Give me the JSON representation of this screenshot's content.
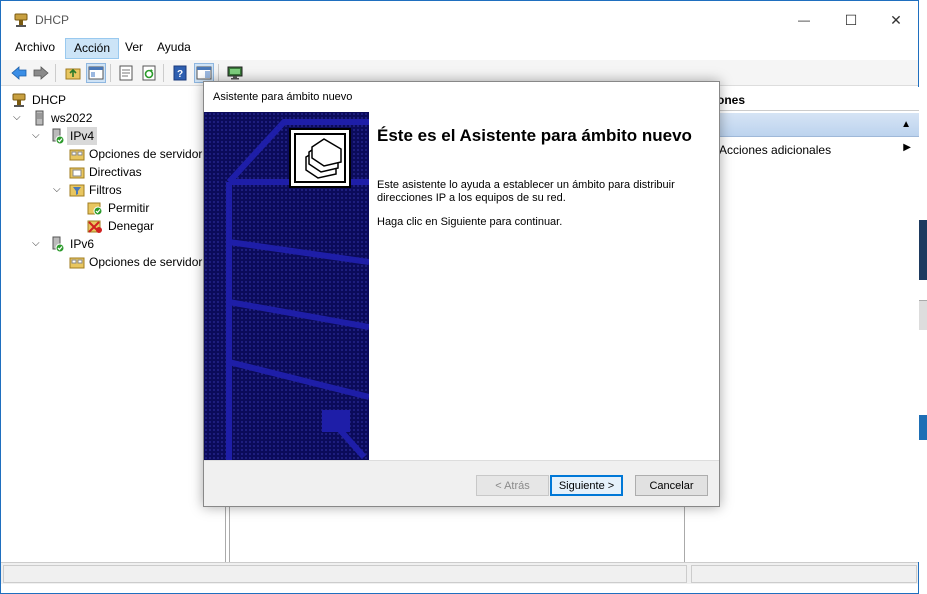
{
  "window": {
    "title": "DHCP",
    "minimize": "—",
    "maximize": "☐",
    "close": "✕"
  },
  "menu": {
    "items": [
      "Archivo",
      "Acción",
      "Ver",
      "Ayuda"
    ],
    "active": "Acción"
  },
  "tree": {
    "root": "DHCP",
    "server": "ws2022",
    "ipv4": "IPv4",
    "ipv4_children": [
      "Opciones de servidor",
      "Directivas",
      "Filtros"
    ],
    "filtros_children": [
      "Permitir",
      "Denegar"
    ],
    "ipv6": "IPv6",
    "ipv6_children": [
      "Opciones de servidor"
    ]
  },
  "actions": {
    "header": "ones",
    "item": "Acciones adicionales"
  },
  "dialog": {
    "title": "Asistente para ámbito nuevo",
    "heading": "Éste es el Asistente para ámbito nuevo",
    "paragraph1": "Este asistente lo ayuda a establecer un ámbito para distribuir direcciones IP a los equipos de su red.",
    "paragraph2": "Haga clic en Siguiente para continuar.",
    "back_label": "< Atrás",
    "next_label": "Siguiente >",
    "cancel_label": "Cancelar"
  },
  "colors": {
    "accent": "#0078d7",
    "wizard_art": "#0b0b5a",
    "desktop": "#1565c0"
  }
}
